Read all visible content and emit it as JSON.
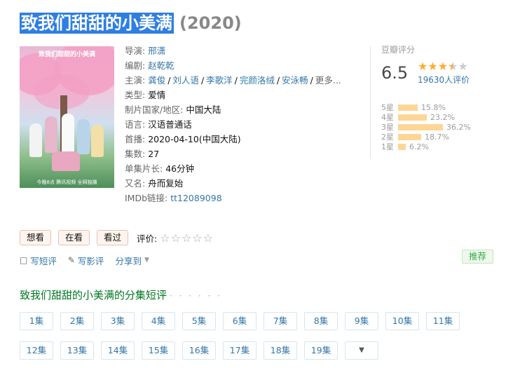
{
  "title": {
    "main": "致我们甜甜的小美满",
    "year": "(2020)"
  },
  "poster": {
    "caption": "致我们甜甜的小美满",
    "footer": "今晚8点 腾讯视频 全网独播"
  },
  "info": {
    "director": {
      "label": "导演: ",
      "value": "邢潇"
    },
    "writer": {
      "label": "编剧: ",
      "value": "赵乾乾"
    },
    "cast": {
      "label": "主演: ",
      "names": [
        "龚俊",
        "刘人语",
        "李歌洋",
        "完颜洛绒",
        "安泳畅"
      ],
      "more": "更多..."
    },
    "genre": {
      "label": "类型: ",
      "value": "爱情"
    },
    "country": {
      "label": "制片国家/地区: ",
      "value": "中国大陆"
    },
    "language": {
      "label": "语言: ",
      "value": "汉语普通话"
    },
    "premiere": {
      "label": "首播: ",
      "value": "2020-04-10(中国大陆)"
    },
    "episodes": {
      "label": "集数: ",
      "value": "27"
    },
    "duration": {
      "label": "单集片长: ",
      "value": "46分钟"
    },
    "aka": {
      "label": "又名: ",
      "value": "舟而复始"
    },
    "imdb": {
      "label": "IMDb链接: ",
      "value": "tt12089098"
    }
  },
  "rating": {
    "label": "豆瓣评分",
    "score": "6.5",
    "stars_value": 3.5,
    "people": "19630人评价",
    "distribution": [
      {
        "level": "5星",
        "percent": 15.8,
        "text": "15.8%"
      },
      {
        "level": "4星",
        "percent": 23.2,
        "text": "23.2%"
      },
      {
        "level": "3星",
        "percent": 36.2,
        "text": "36.2%"
      },
      {
        "level": "2星",
        "percent": 18.7,
        "text": "18.7%"
      },
      {
        "level": "1星",
        "percent": 6.2,
        "text": "6.2%"
      }
    ]
  },
  "actions": {
    "want": "想看",
    "watching": "在看",
    "watched": "看过",
    "rate_label": "评价:",
    "short_review": "写短评",
    "review": "写影评",
    "share": "分享到",
    "recommend": "推荐"
  },
  "episodes_section": {
    "title": "致我们甜甜的小美满的分集短评",
    "dots": "· · · · · ·",
    "items": [
      "1集",
      "2集",
      "3集",
      "4集",
      "5集",
      "6集",
      "7集",
      "8集",
      "9集",
      "10集",
      "11集",
      "12集",
      "13集",
      "14集",
      "15集",
      "16集",
      "17集",
      "18集",
      "19集"
    ]
  },
  "colors": {
    "link": "#3377aa",
    "title_highlight": "#2f7fe0",
    "star": "#ffac2d",
    "bar": "#ffd596",
    "green": "#007722"
  }
}
